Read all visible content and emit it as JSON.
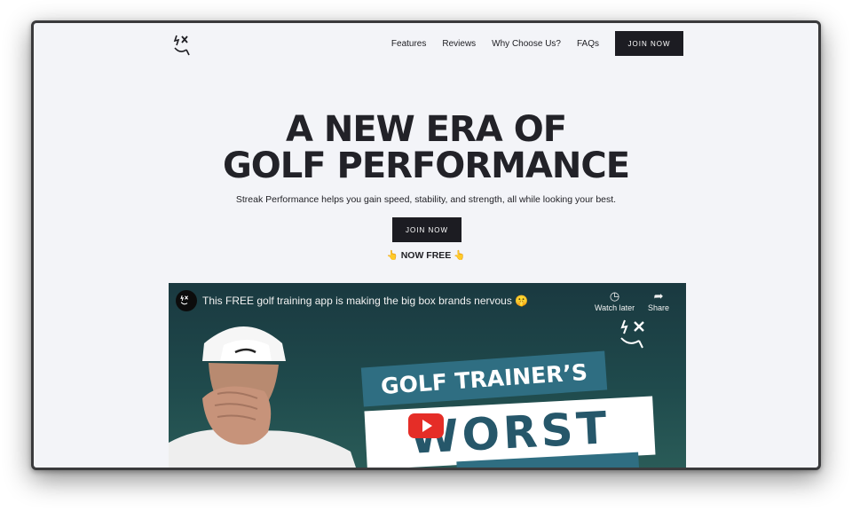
{
  "nav": {
    "links": [
      "Features",
      "Reviews",
      "Why Choose Us?",
      "FAQs"
    ],
    "join_label": "JOIN NOW"
  },
  "hero": {
    "title_line1": "A NEW ERA OF",
    "title_line2": "GOLF PERFORMANCE",
    "subtitle": "Streak Performance helps you gain speed, stability, and strength, all while looking your best.",
    "join_label": "JOIN NOW",
    "free_label": "NOW FREE",
    "free_emoji": "👆"
  },
  "video": {
    "title": "This FREE golf training app is making the big box brands nervous 🤫",
    "watch_later_label": "Watch later",
    "share_label": "Share",
    "thumb_line1": "GOLF TRAINER’S",
    "thumb_line2": "WORST"
  },
  "colors": {
    "background": "#f3f4f8",
    "dark_button": "#1c1c22",
    "thumb_teal": "#2f6e82",
    "play_red": "#e52d27"
  }
}
